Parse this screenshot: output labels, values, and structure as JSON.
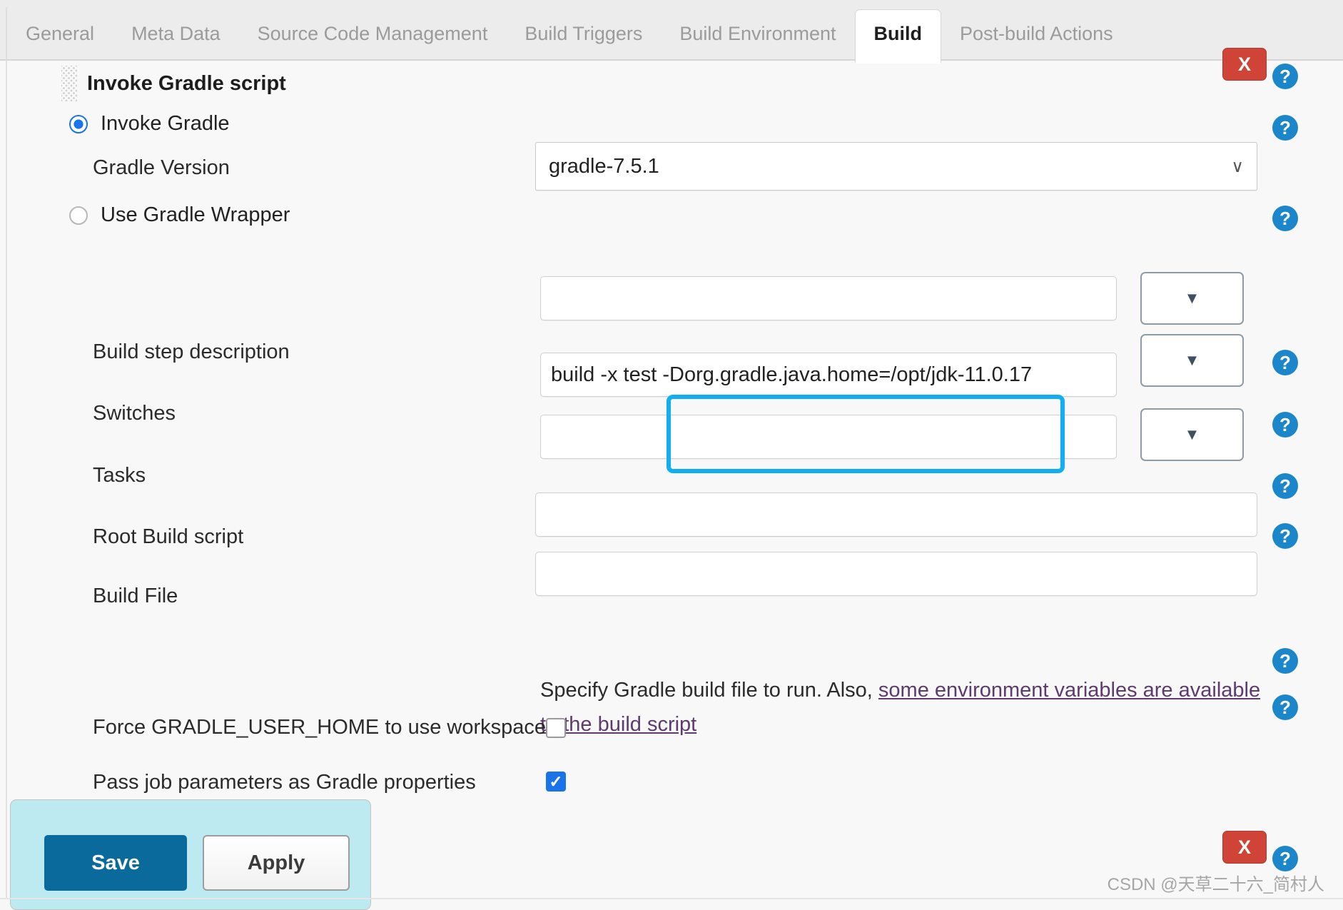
{
  "tabs": [
    {
      "label": "General",
      "active": false
    },
    {
      "label": "Meta Data",
      "active": false
    },
    {
      "label": "Source Code Management",
      "active": false
    },
    {
      "label": "Build Triggers",
      "active": false
    },
    {
      "label": "Build Environment",
      "active": false
    },
    {
      "label": "Build",
      "active": true
    },
    {
      "label": "Post-build Actions",
      "active": false
    }
  ],
  "builder": {
    "title": "Invoke Gradle script",
    "delete_label": "X"
  },
  "radios": [
    {
      "label": "Invoke Gradle",
      "checked": true
    },
    {
      "label": "Use Gradle Wrapper",
      "checked": false
    }
  ],
  "fields": {
    "gradle_version": {
      "label": "Gradle Version",
      "value": "gradle-7.5.1",
      "chevron": "∨"
    },
    "build_step_description": {
      "label": "Build step description",
      "value": "",
      "placeholder": ""
    },
    "switches": {
      "label": "Switches",
      "value": "build -x test -Dorg.gradle.java.home=/opt/jdk-11.0.17",
      "value_prefix": "build -x test",
      "value_highlighted": "-Dorg.gradle.java.home=/opt/jdk-11.0.17",
      "placeholder": ""
    },
    "tasks": {
      "label": "Tasks",
      "value": "",
      "placeholder": ""
    },
    "root_build_script": {
      "label": "Root Build script",
      "value": "",
      "placeholder": ""
    },
    "build_file": {
      "label": "Build File",
      "value": "",
      "placeholder": ""
    }
  },
  "dropdown_buttons": {
    "glyph": "▼"
  },
  "help_text": {
    "prefix": "Specify Gradle build file to run. Also, ",
    "link": "some environment variables are available to the build script"
  },
  "checkboxes": [
    {
      "label": "Force GRADLE_USER_HOME to use workspace",
      "checked": false,
      "mark": ""
    },
    {
      "label": "Pass job parameters as Gradle properties",
      "checked": true,
      "mark": "✓"
    }
  ],
  "actions": {
    "save_label": "Save",
    "apply_label": "Apply"
  },
  "help_icon": {
    "glyph": "?"
  },
  "watermark": "CSDN @天草二十六_简村人",
  "colors": {
    "accent_blue": "#1a73e8",
    "help_blue": "#1b86c9",
    "highlight_cyan": "#12aff0",
    "delete_red": "#cf4436",
    "save_blue": "#0a6a9b",
    "action_bar": "#bdeaf0",
    "link_purple": "#5d3b6e"
  }
}
